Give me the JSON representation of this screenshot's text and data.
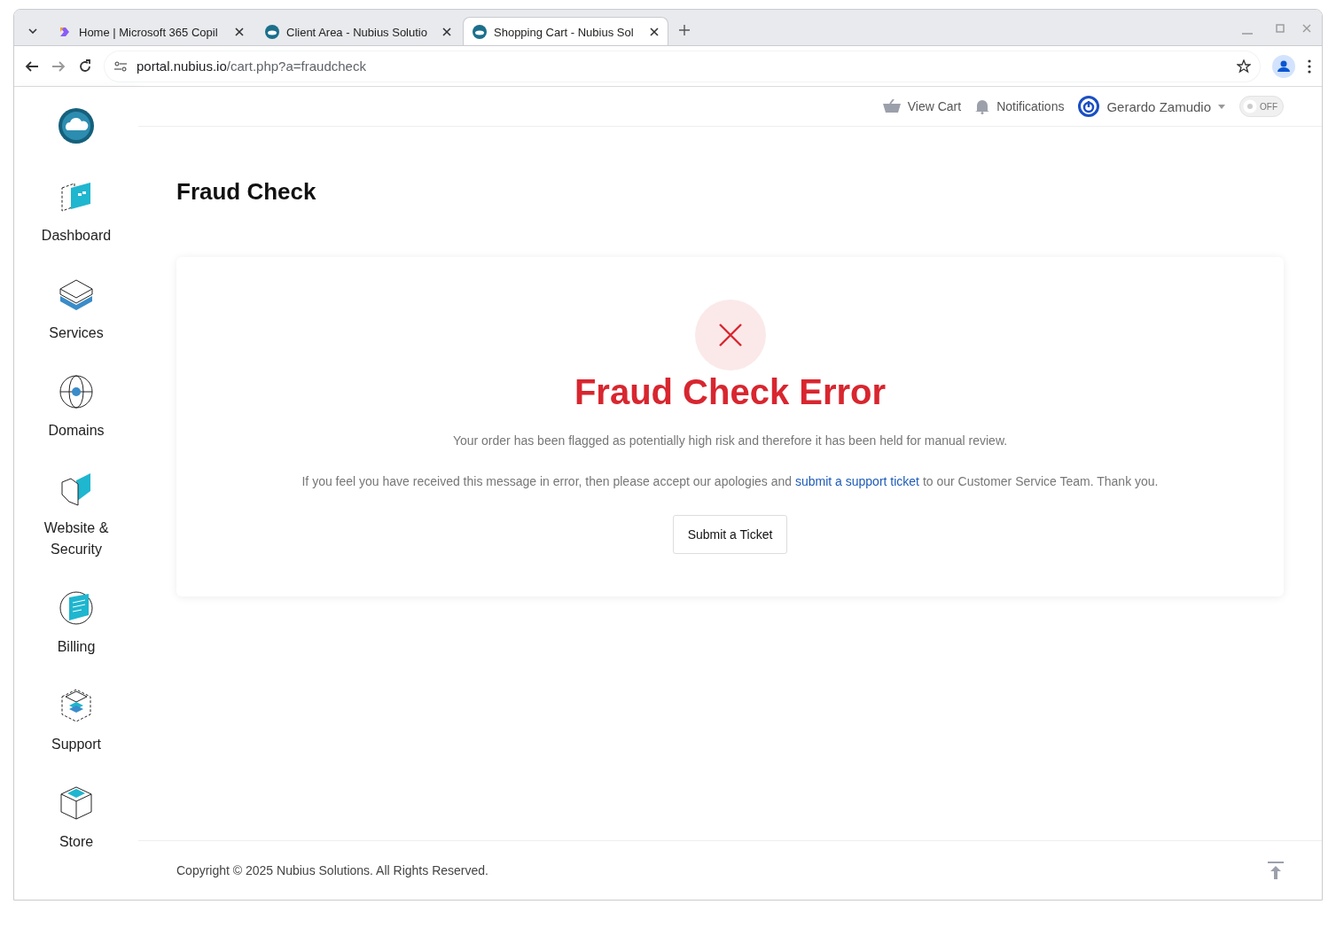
{
  "browser": {
    "tabs": [
      {
        "title": "Home | Microsoft 365 Copil",
        "selected": false,
        "kind": "copilot"
      },
      {
        "title": "Client Area - Nubius Solutio",
        "selected": false,
        "kind": "site"
      },
      {
        "title": "Shopping Cart - Nubius Sol",
        "selected": true,
        "kind": "site"
      }
    ],
    "url_host": "portal.nubius.io",
    "url_path": "/cart.php?a=fraudcheck"
  },
  "header": {
    "view_cart": "View Cart",
    "notifications": "Notifications",
    "user": "Gerardo Zamudio",
    "theme_toggle": {
      "label": "OFF",
      "on": false
    }
  },
  "sidebar": {
    "items": [
      {
        "label": "Dashboard"
      },
      {
        "label": "Services"
      },
      {
        "label": "Domains"
      },
      {
        "label": "Website & Security"
      },
      {
        "label": "Billing"
      },
      {
        "label": "Support"
      },
      {
        "label": "Store"
      }
    ]
  },
  "page_title": "Fraud Check",
  "error": {
    "title": "Fraud Check Error",
    "message": "Your order has been flagged as potentially high risk and therefore it has been held for manual review.",
    "apology_before": "If you feel you have received this message in error, then please accept our apologies and ",
    "apology_link": "submit a support ticket",
    "apology_after": " to our Customer Service Team. Thank you.",
    "button": "Submit a Ticket"
  },
  "footer": {
    "copyright": "Copyright © 2025 Nubius Solutions. All Rights Reserved."
  }
}
